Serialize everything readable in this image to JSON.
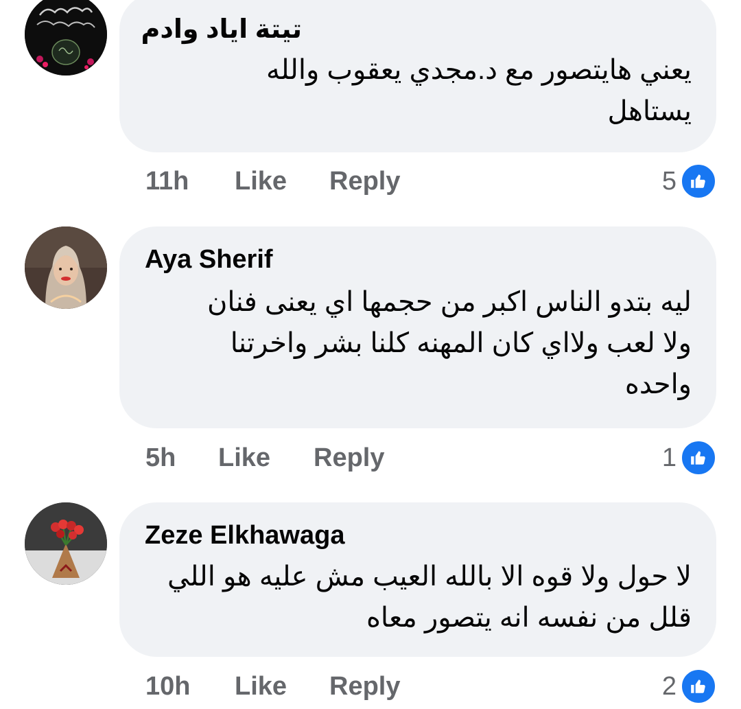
{
  "comments": [
    {
      "author": "تيتة اياد وادم",
      "text_lines": [
        "يعني هايتصور مع د.مجدي يعقوب والله",
        "يستاهل"
      ],
      "time": "11h",
      "like_label": "Like",
      "reply_label": "Reply",
      "reaction_count": "5",
      "reaction_type": "like-icon",
      "avatar": "islamic-calligraphy-avatar"
    },
    {
      "author": "Aya Sherif",
      "text_lines": [
        "ليه بتدو الناس اكبر من حجمها اي يعنى فنان",
        "ولا لعب ولااي كان المهنه كلنا بشر واخرتنا",
        "واحده"
      ],
      "time": "5h",
      "like_label": "Like",
      "reply_label": "Reply",
      "reaction_count": "1",
      "reaction_type": "like-icon",
      "avatar": "woman-hijab-avatar"
    },
    {
      "author": "Zeze Elkhawaga",
      "text_lines": [
        "لا حول ولا قوه الا بالله العيب مش عليه هو اللي",
        "قلل من نفسه انه يتصور معاه"
      ],
      "time": "10h",
      "like_label": "Like",
      "reply_label": "Reply",
      "reaction_count": "2",
      "reaction_type": "like-icon",
      "avatar": "flower-bouquet-avatar"
    }
  ],
  "colors": {
    "bubble": "#f0f2f5",
    "text": "#050505",
    "meta": "#65676b",
    "like_blue": "#1877f2"
  }
}
